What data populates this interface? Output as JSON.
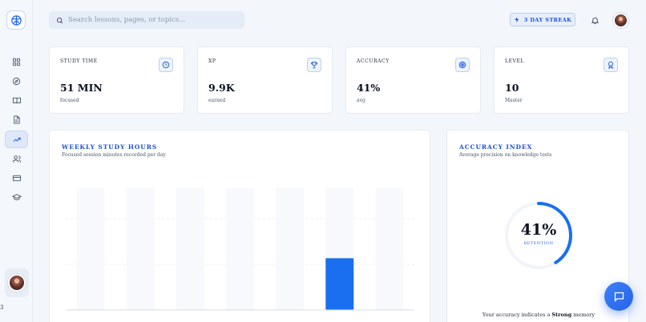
{
  "search": {
    "placeholder": "Search lessons, pages, or topics..."
  },
  "header": {
    "streak_label": "3 DAY STREAK"
  },
  "sidebar": {
    "items": [
      {
        "name": "dashboard-grid-icon",
        "active": false
      },
      {
        "name": "compass-icon",
        "active": false
      },
      {
        "name": "book-icon",
        "active": false
      },
      {
        "name": "document-icon",
        "active": false
      },
      {
        "name": "trending-icon",
        "active": true
      },
      {
        "name": "users-icon",
        "active": false
      },
      {
        "name": "credit-card-icon",
        "active": false
      },
      {
        "name": "graduation-cap-icon",
        "active": false
      }
    ]
  },
  "stats": [
    {
      "label": "STUDY TIME",
      "value": "51 MIN",
      "sub": "focused",
      "icon": "clock-icon"
    },
    {
      "label": "XP",
      "value": "9.9K",
      "sub": "earned",
      "icon": "trophy-icon"
    },
    {
      "label": "ACCURACY",
      "value": "41%",
      "sub": "avg",
      "icon": "target-icon"
    },
    {
      "label": "LEVEL",
      "value": "10",
      "sub": "Master",
      "icon": "award-icon"
    }
  ],
  "weekly": {
    "title": "WEEKLY STUDY HOURS",
    "subtitle": "Focused session minutes recorded per day"
  },
  "chart_data": {
    "type": "bar",
    "categories": [
      "",
      "",
      "",
      "",
      "",
      "",
      ""
    ],
    "values": [
      0,
      0,
      0,
      0,
      0,
      51,
      0
    ],
    "title": "WEEKLY STUDY HOURS",
    "xlabel": "",
    "ylabel": "",
    "ylim": [
      0,
      120
    ],
    "grid": true,
    "accent": "#1a6ff0"
  },
  "accuracy": {
    "title": "ACCURACY INDEX",
    "subtitle": "Average precision on knowledge tests",
    "value": "41%",
    "percent": 41,
    "label": "RETENTION",
    "note_prefix": "Your accuracy indicates a ",
    "note_strong": "Strong",
    "note_suffix": " memory"
  },
  "misc": {
    "left_glyph": "3"
  },
  "colors": {
    "accent": "#2563eb",
    "background": "#f3f6fb"
  }
}
